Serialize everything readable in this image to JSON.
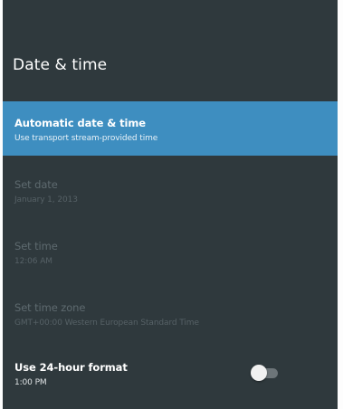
{
  "header": {
    "title": "Date & time"
  },
  "items": [
    {
      "title": "Automatic date & time",
      "subtitle": "Use transport stream-provided time",
      "state": "selected"
    },
    {
      "title": "Set date",
      "subtitle": "January 1, 2013",
      "state": "disabled"
    },
    {
      "title": "Set time",
      "subtitle": "12:06 AM",
      "state": "disabled"
    },
    {
      "title": "Set time zone",
      "subtitle": "GMT+00:00 Western European Standard Time",
      "state": "disabled"
    },
    {
      "title": "Use 24-hour format",
      "subtitle": "1:00 PM",
      "state": "normal",
      "toggle_on": false
    }
  ],
  "colors": {
    "background": "#2f393d",
    "selected": "#3e8ec0",
    "disabled_text": "#5e6a6f"
  }
}
